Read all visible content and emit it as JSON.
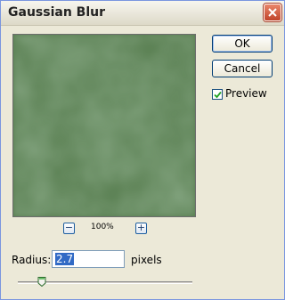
{
  "window": {
    "title": "Gaussian Blur"
  },
  "buttons": {
    "ok": "OK",
    "cancel": "Cancel"
  },
  "preview": {
    "label": "Preview",
    "checked": true
  },
  "zoom": {
    "level": "100%",
    "minus": "−",
    "plus": "+"
  },
  "radius": {
    "label": "Radius:",
    "value": "2.7",
    "units": "pixels",
    "slider_fraction": 0.14
  },
  "colors": {
    "preview_base": "#577d4f",
    "accent": "#316ac5"
  },
  "icons": {
    "close": "close-icon",
    "check": "checkmark-icon"
  }
}
